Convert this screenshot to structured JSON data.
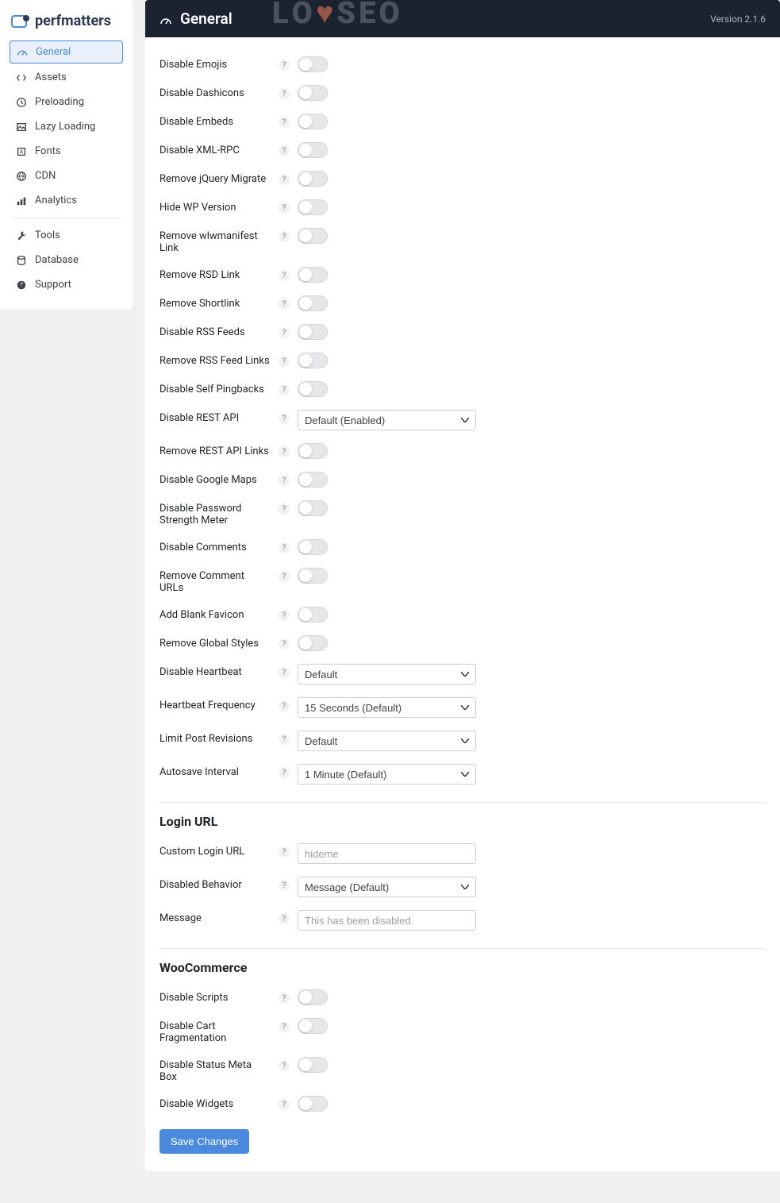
{
  "brand": "perfmatters",
  "header": {
    "title": "General",
    "version": "Version 2.1.6"
  },
  "watermark": {
    "l": "L",
    "o": "O",
    "heart": "♥",
    "s": "S",
    "e": "E",
    "o2": "O"
  },
  "sidebar": {
    "items": [
      {
        "label": "General",
        "active": true
      },
      {
        "label": "Assets"
      },
      {
        "label": "Preloading"
      },
      {
        "label": "Lazy Loading"
      },
      {
        "label": "Fonts"
      },
      {
        "label": "CDN"
      },
      {
        "label": "Analytics"
      }
    ],
    "items2": [
      {
        "label": "Tools"
      },
      {
        "label": "Database"
      },
      {
        "label": "Support"
      }
    ]
  },
  "help_char": "?",
  "general_rows": [
    {
      "label": "Disable Emojis",
      "type": "toggle"
    },
    {
      "label": "Disable Dashicons",
      "type": "toggle"
    },
    {
      "label": "Disable Embeds",
      "type": "toggle"
    },
    {
      "label": "Disable XML-RPC",
      "type": "toggle"
    },
    {
      "label": "Remove jQuery Migrate",
      "type": "toggle"
    },
    {
      "label": "Hide WP Version",
      "type": "toggle"
    },
    {
      "label": "Remove wlwmanifest Link",
      "type": "toggle"
    },
    {
      "label": "Remove RSD Link",
      "type": "toggle"
    },
    {
      "label": "Remove Shortlink",
      "type": "toggle"
    },
    {
      "label": "Disable RSS Feeds",
      "type": "toggle"
    },
    {
      "label": "Remove RSS Feed Links",
      "type": "toggle"
    },
    {
      "label": "Disable Self Pingbacks",
      "type": "toggle"
    },
    {
      "label": "Disable REST API",
      "type": "select",
      "value": "Default (Enabled)"
    },
    {
      "label": "Remove REST API Links",
      "type": "toggle"
    },
    {
      "label": "Disable Google Maps",
      "type": "toggle"
    },
    {
      "label": "Disable Password Strength Meter",
      "type": "toggle"
    },
    {
      "label": "Disable Comments",
      "type": "toggle"
    },
    {
      "label": "Remove Comment URLs",
      "type": "toggle"
    },
    {
      "label": "Add Blank Favicon",
      "type": "toggle"
    },
    {
      "label": "Remove Global Styles",
      "type": "toggle"
    },
    {
      "label": "Disable Heartbeat",
      "type": "select",
      "value": "Default"
    },
    {
      "label": "Heartbeat Frequency",
      "type": "select",
      "value": "15 Seconds (Default)"
    },
    {
      "label": "Limit Post Revisions",
      "type": "select",
      "value": "Default"
    },
    {
      "label": "Autosave Interval",
      "type": "select",
      "value": "1 Minute (Default)"
    }
  ],
  "login_section": {
    "title": "Login URL",
    "rows": [
      {
        "label": "Custom Login URL",
        "type": "text",
        "placeholder": "hideme"
      },
      {
        "label": "Disabled Behavior",
        "type": "select",
        "value": "Message (Default)"
      },
      {
        "label": "Message",
        "type": "text",
        "placeholder": "This has been disabled."
      }
    ]
  },
  "woo_section": {
    "title": "WooCommerce",
    "rows": [
      {
        "label": "Disable Scripts",
        "type": "toggle"
      },
      {
        "label": "Disable Cart Fragmentation",
        "type": "toggle"
      },
      {
        "label": "Disable Status Meta Box",
        "type": "toggle"
      },
      {
        "label": "Disable Widgets",
        "type": "toggle"
      }
    ]
  },
  "save_label": "Save Changes"
}
